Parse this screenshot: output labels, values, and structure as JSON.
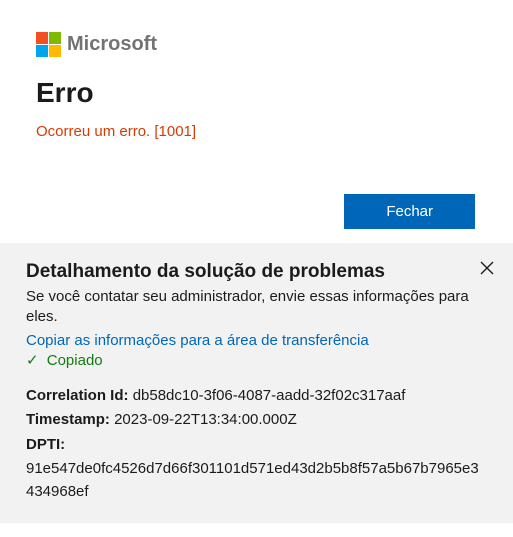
{
  "logo": {
    "text": "Microsoft"
  },
  "error": {
    "title": "Erro",
    "message": "Ocorreu um erro. [1001]"
  },
  "buttons": {
    "close": "Fechar"
  },
  "details": {
    "title": "Detalhamento da solução de problemas",
    "description": "Se você contatar seu administrador, envie essas informações para eles.",
    "copy_link": "Copiar as informações para a área de transferência",
    "copied": "Copiado",
    "fields": {
      "correlation_label": "Correlation Id:",
      "correlation_value": "db58dc10-3f06-4087-aadd-32f02c317aaf",
      "timestamp_label": "Timestamp:",
      "timestamp_value": "2023-09-22T13:34:00.000Z",
      "dpti_label": "DPTI:",
      "dpti_value": "91e547de0fc4526d7d66f301101d571ed43d2b5b8f57a5b67b7965e3434968ef"
    }
  }
}
